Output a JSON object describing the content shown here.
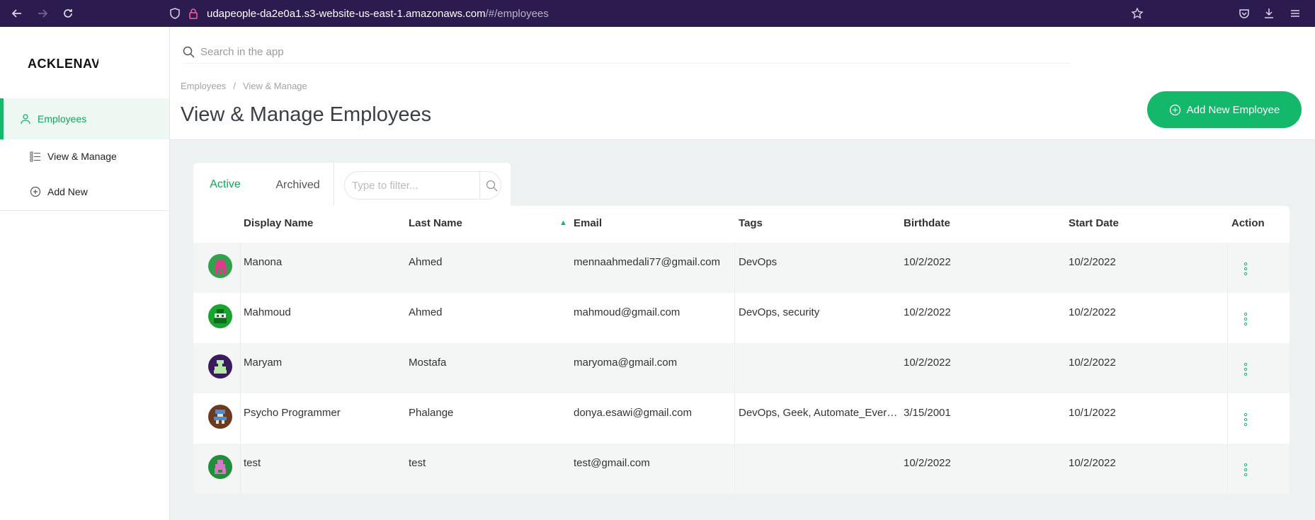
{
  "browser": {
    "url_host": "udapeople-da2e0a1.s3-website-us-east-1.amazonaws.com",
    "url_path": "/#/employees"
  },
  "sidebar": {
    "logo": "ACKLENAV",
    "items": [
      {
        "label": "Employees",
        "icon": "user-icon"
      },
      {
        "label": "View & Manage",
        "icon": "list-icon"
      },
      {
        "label": "Add New",
        "icon": "plus-circle-icon"
      }
    ]
  },
  "header": {
    "search_placeholder": "Search in the app",
    "breadcrumb": [
      "Employees",
      "/",
      "View & Manage"
    ],
    "title": "View & Manage Employees",
    "add_button": "Add New Employee"
  },
  "tabs": [
    {
      "label": "Active",
      "active": true
    },
    {
      "label": "Archived",
      "active": false
    }
  ],
  "filter_placeholder": "Type to filter...",
  "table": {
    "columns": [
      "Display Name",
      "Last Name",
      "Email",
      "Tags",
      "Birthdate",
      "Start Date",
      "Action"
    ],
    "sort_indicator": "▲",
    "rows": [
      {
        "display_name": "Manona",
        "last_name": "Ahmed",
        "email": "mennaahmedali77@gmail.com",
        "tags": "DevOps",
        "birthdate": "10/2/2022",
        "start_date": "10/2/2022"
      },
      {
        "display_name": "Mahmoud",
        "last_name": "Ahmed",
        "email": "mahmoud@gmail.com",
        "tags": "DevOps, security",
        "birthdate": "10/2/2022",
        "start_date": "10/2/2022"
      },
      {
        "display_name": "Maryam",
        "last_name": "Mostafa",
        "email": "maryoma@gmail.com",
        "tags": "",
        "birthdate": "10/2/2022",
        "start_date": "10/2/2022"
      },
      {
        "display_name": "Psycho Programmer",
        "last_name": "Phalange",
        "email": "donya.esawi@gmail.com",
        "tags": "DevOps, Geek, Automate_Every...",
        "birthdate": "3/15/2001",
        "start_date": "10/1/2022"
      },
      {
        "display_name": "test",
        "last_name": "test",
        "email": "test@gmail.com",
        "tags": "",
        "birthdate": "10/2/2022",
        "start_date": "10/2/2022"
      }
    ]
  },
  "colors": {
    "accent": "#14b86a",
    "browser_bar": "#2b1b4f"
  }
}
